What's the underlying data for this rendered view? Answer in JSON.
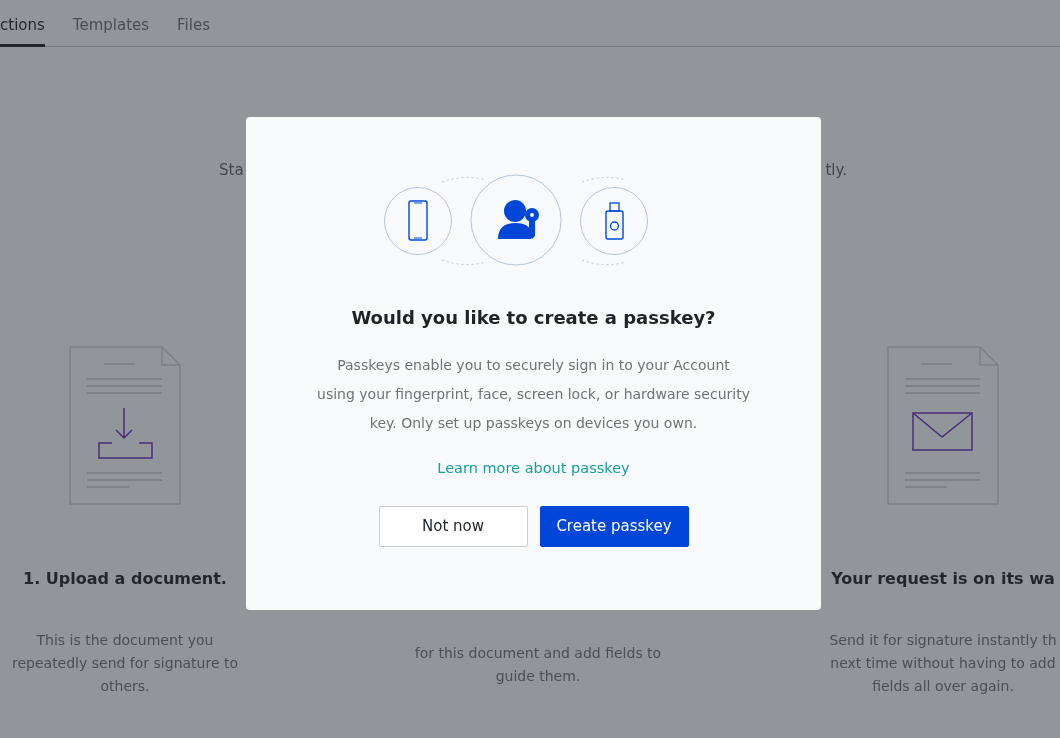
{
  "tabs": [
    {
      "label": "ctions",
      "selected": true
    },
    {
      "label": "Templates",
      "selected": false
    },
    {
      "label": "Files",
      "selected": false
    }
  ],
  "intro": {
    "left_fragment": "Sta",
    "right_fragment": "tly."
  },
  "steps": [
    {
      "kind": "upload",
      "title": "1. Upload a document.",
      "lines": [
        "This is the document you",
        "repeatedly send for signature to",
        "others."
      ]
    },
    {
      "kind": "fields",
      "lines": [
        "for this document and add fields to",
        "guide them."
      ]
    },
    {
      "kind": "send",
      "title": "Your request is on its wa",
      "lines": [
        "Send it for signature instantly th",
        "next time without having to add",
        "fields all over again."
      ]
    }
  ],
  "dialog": {
    "title": "Would you like to create a passkey?",
    "body": [
      "Passkeys enable you to securely sign in to your Account",
      "using your fingerprint, face, screen lock, or hardware security",
      "key. Only set up passkeys on devices you own."
    ],
    "link": "Learn more about passkey",
    "buttons": [
      {
        "label": "Not now",
        "kind": "secondary"
      },
      {
        "label": "Create passkey",
        "kind": "primary"
      }
    ]
  }
}
